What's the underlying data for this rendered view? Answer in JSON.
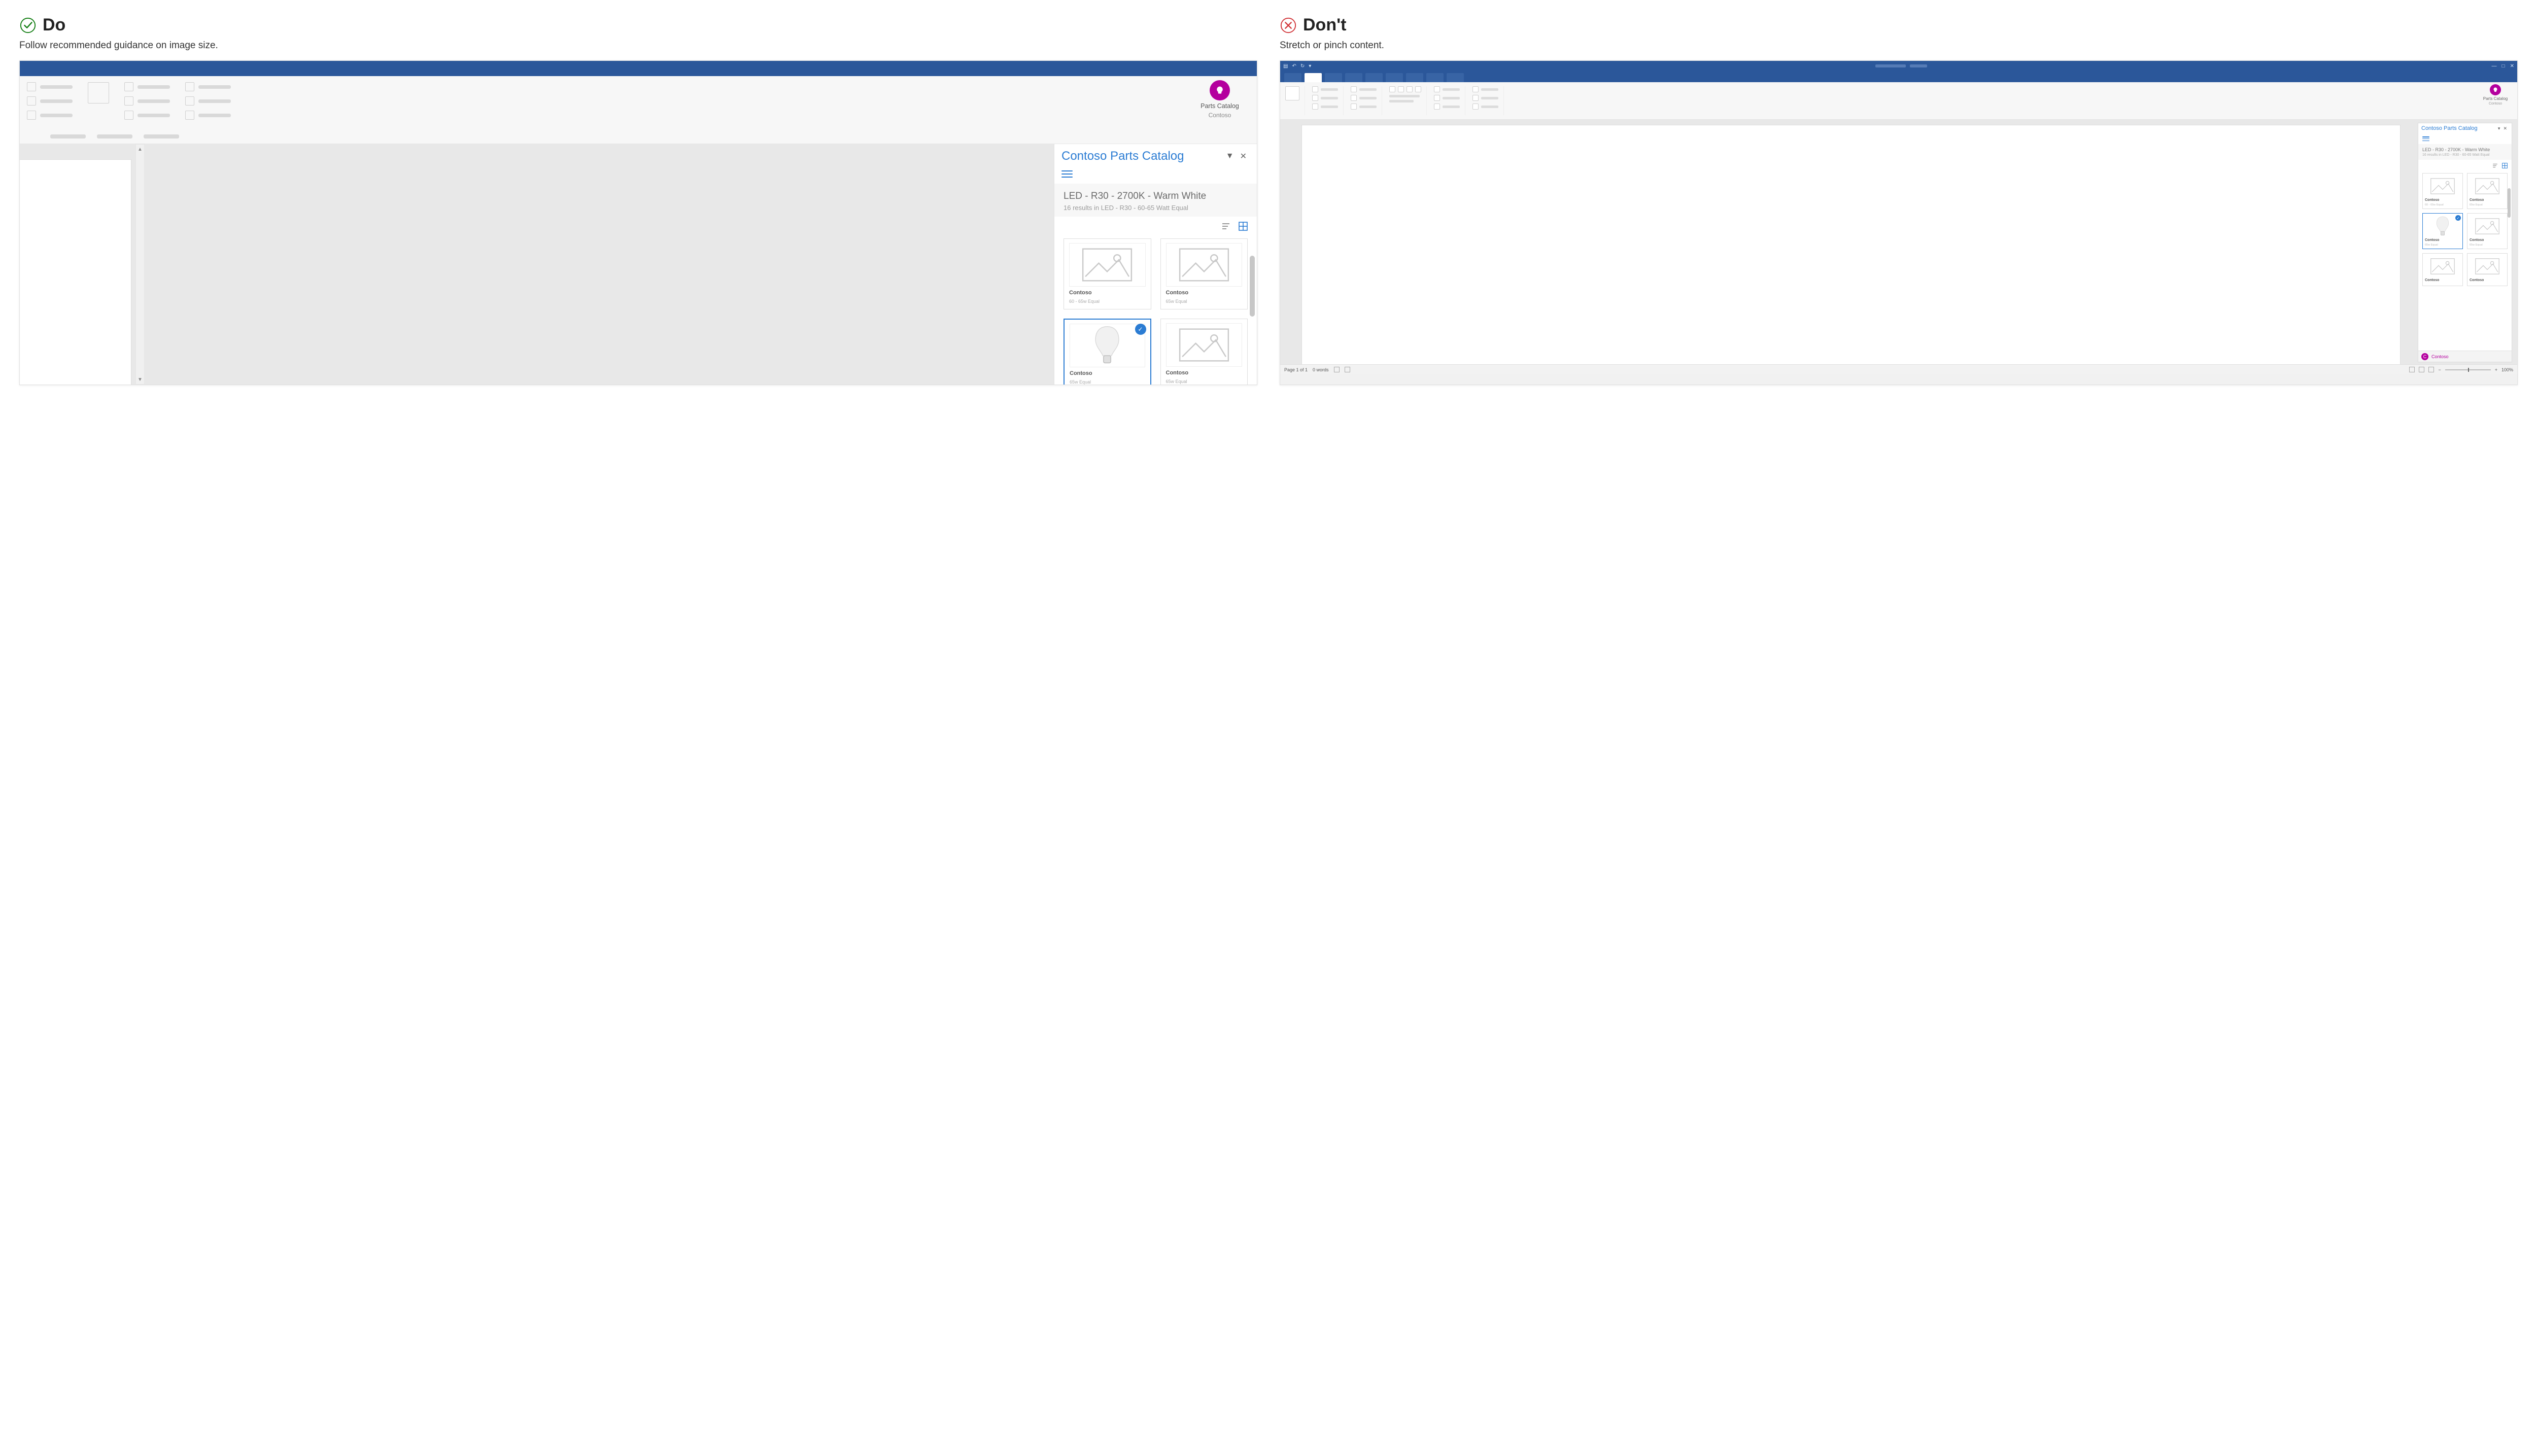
{
  "do": {
    "badge_title": "Do",
    "subtitle": "Follow recommended guidance on image size.",
    "addin": {
      "line1": "Parts Catalog",
      "line2": "Contoso"
    },
    "taskpane": {
      "title": "Contoso Parts Catalog",
      "breadcrumb_title": "LED - R30 - 2700K - Warm White",
      "breadcrumb_sub": "16 results in LED - R30 - 60-65 Watt Equal",
      "cards": [
        {
          "brand": "Contoso",
          "sub": "60 - 65w Equal"
        },
        {
          "brand": "Contoso",
          "sub": "65w Equal"
        },
        {
          "brand": "Contoso",
          "sub": "65w Equal",
          "selected": true,
          "bulb": true
        },
        {
          "brand": "Contoso",
          "sub": "65w Equal"
        }
      ]
    }
  },
  "dont": {
    "badge_title": "Don't",
    "subtitle": "Stretch or pinch content.",
    "addin": {
      "line1": "Parts Catalog",
      "line2": "Contoso"
    },
    "taskpane": {
      "title": "Contoso Parts Catalog",
      "breadcrumb_title": "LED - R30 - 2700K - Warm White",
      "breadcrumb_sub": "16 results in LED - R30 - 60-65 Watt Equal",
      "footer_brand": "Contoso",
      "cards": [
        {
          "brand": "Contoso",
          "sub": "60 - 65w Equal"
        },
        {
          "brand": "Contoso",
          "sub": "65w Equal"
        },
        {
          "brand": "Contoso",
          "sub": "65w Equal",
          "selected": true,
          "bulb": true
        },
        {
          "brand": "Contoso",
          "sub": "65w Equal"
        },
        {
          "brand": "Contoso",
          "sub": ""
        },
        {
          "brand": "Contoso",
          "sub": ""
        }
      ]
    },
    "status": {
      "page": "Page 1 of 1",
      "words": "0 words",
      "zoom": "100%"
    }
  }
}
